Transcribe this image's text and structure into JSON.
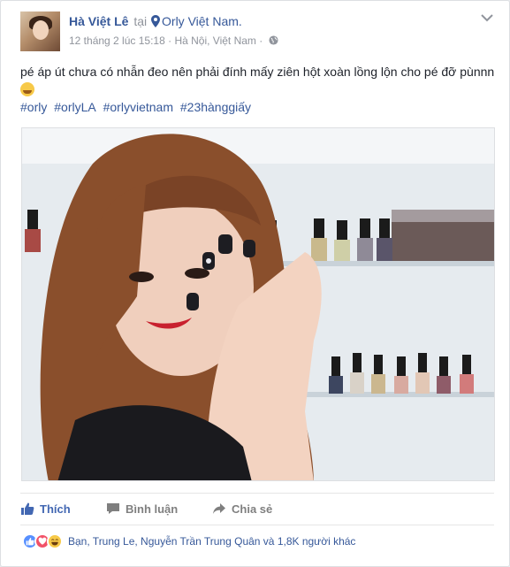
{
  "post": {
    "author": "Hà Việt Lê",
    "at_word": "tại",
    "place": "Orly Việt Nam.",
    "timestamp": "12 tháng 2 lúc 15:18",
    "meta_sep": "·",
    "location": "Hà Nội, Việt Nam",
    "text": "pé áp út chưa có nhẫn đeo nên phải đính mấy ziên hột xoàn lồng lộn cho pé đỡ pùnnn",
    "hashtags": [
      "#orly",
      "#orlyLA",
      "#orlyvietnam",
      "#23hànggiấy"
    ]
  },
  "actions": {
    "like_label": "Thích",
    "comment_label": "Bình luận",
    "share_label": "Chia sẻ"
  },
  "reactions": {
    "summary": "Bạn, Trung Le, Nguyễn Trần Trung Quân và 1,8K người khác"
  },
  "colors": {
    "link": "#365899",
    "liked": "#4267b2",
    "meta": "#90949c"
  }
}
